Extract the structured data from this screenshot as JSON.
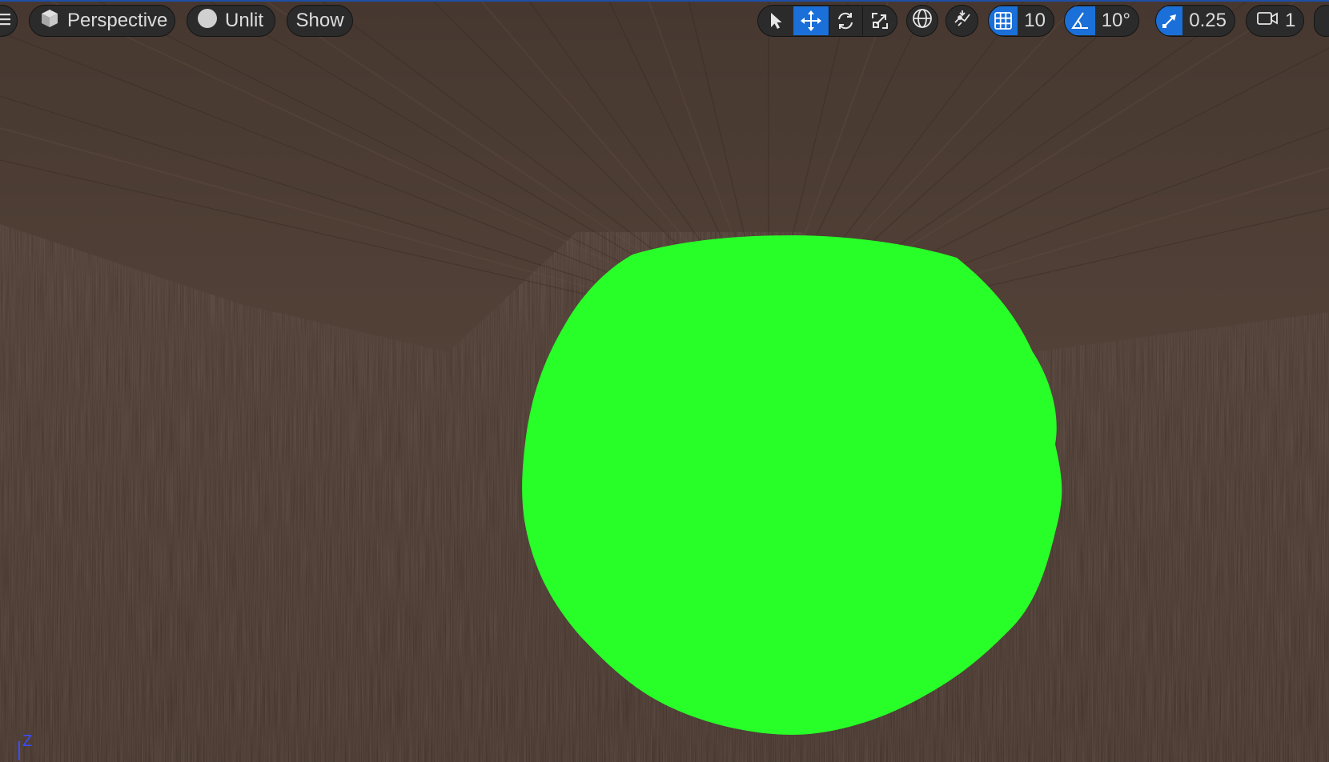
{
  "viewport": {
    "view_mode_label": "Perspective",
    "lighting_label": "Unlit",
    "show_label": "Show",
    "active_transform_tool": "translate",
    "grid_snap_value": "10",
    "rotation_snap_value": "10°",
    "scale_snap_value": "0.25",
    "camera_speed_value": "1",
    "axis_indicator_label": "Z"
  },
  "colors": {
    "accent": "#1a6fd8",
    "toolbar_background": "#2b2b2b",
    "toolbar_text": "#dcdcdc",
    "sphere": "#28ff28",
    "wood": "#4a3a30",
    "axis_z": "#3a4dff"
  },
  "icons": {
    "menu": "hamburger-icon",
    "view_mode": "cube-icon",
    "lighting": "sphere-icon",
    "select": "cursor-arrow-icon",
    "translate": "move-arrows-icon",
    "rotate": "rotate-icon",
    "scale": "scale-icon",
    "world_local": "globe-icon",
    "surface_snap": "surface-snap-icon",
    "grid_snap": "grid-icon",
    "rotation_snap": "angle-icon",
    "scale_snap": "scale-arrow-icon",
    "camera": "video-camera-icon"
  }
}
